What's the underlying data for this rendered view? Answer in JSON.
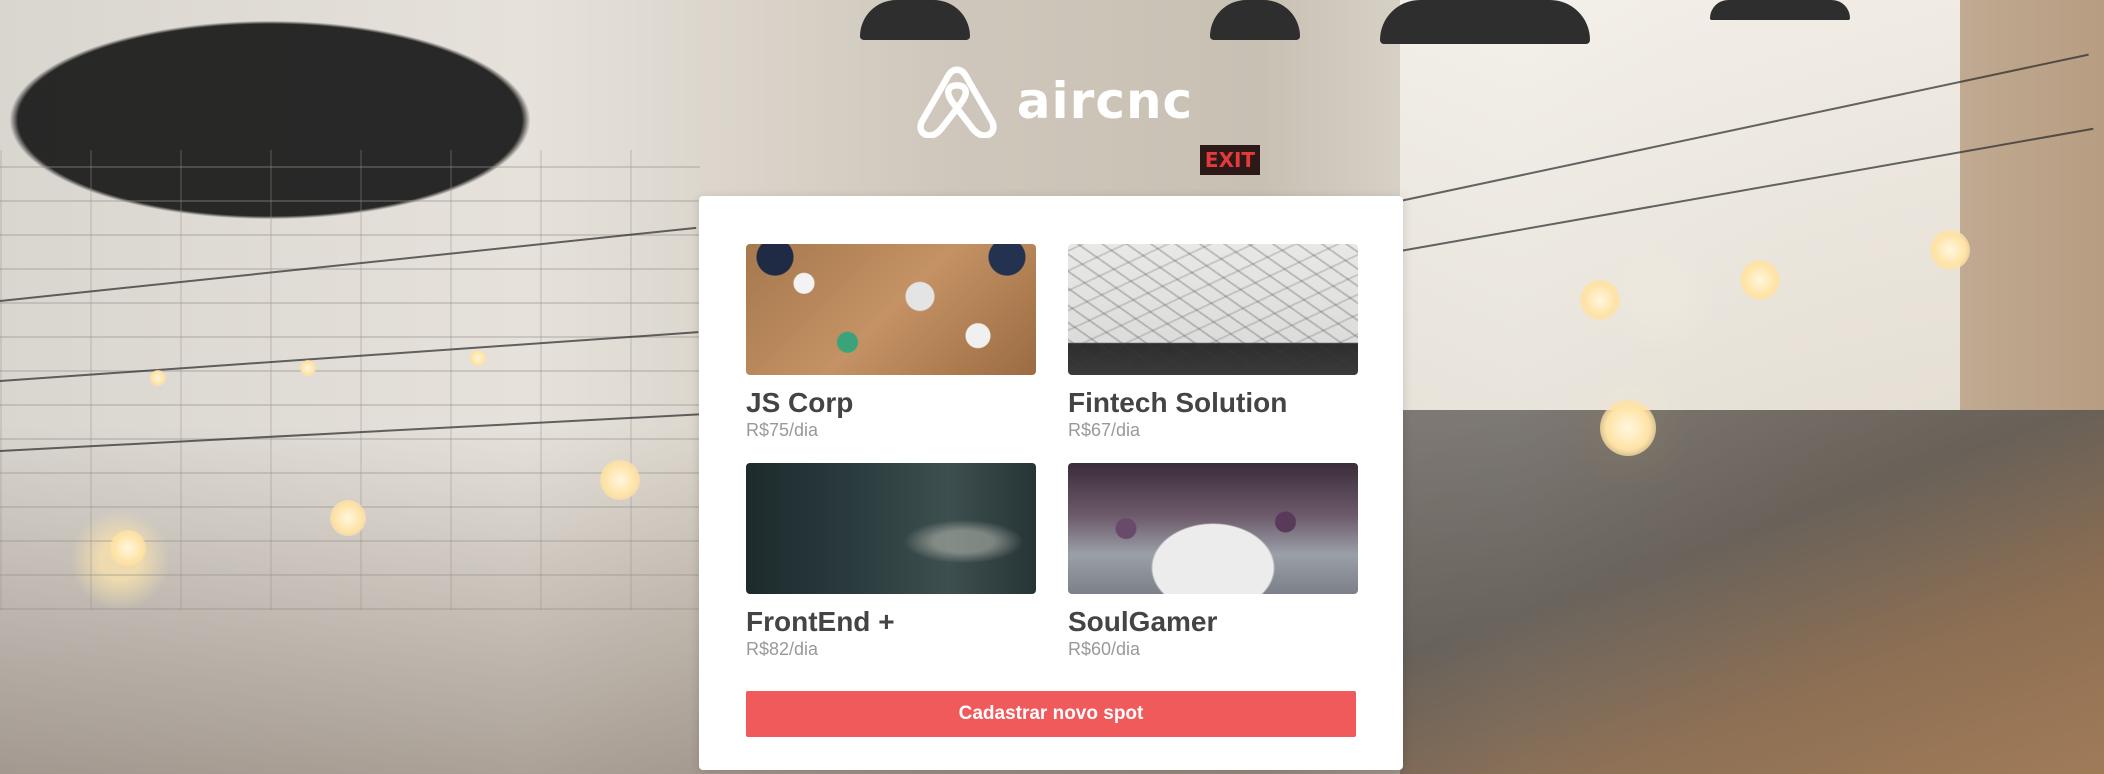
{
  "app": {
    "logo_text": "aircnc",
    "logo_icon": "airbnb-belo-icon"
  },
  "spots": [
    {
      "name": "JS Corp",
      "price": "R$75/dia"
    },
    {
      "name": "Fintech Solution",
      "price": "R$67/dia"
    },
    {
      "name": "FrontEnd +",
      "price": "R$82/dia"
    },
    {
      "name": "SoulGamer",
      "price": "R$60/dia"
    }
  ],
  "actions": {
    "new_spot_label": "Cadastrar novo spot"
  },
  "colors": {
    "accent": "#f05a5b",
    "title_text": "#444444",
    "price_text": "#999999",
    "card_bg": "#ffffff"
  },
  "background": {
    "signage": "EXIT"
  }
}
